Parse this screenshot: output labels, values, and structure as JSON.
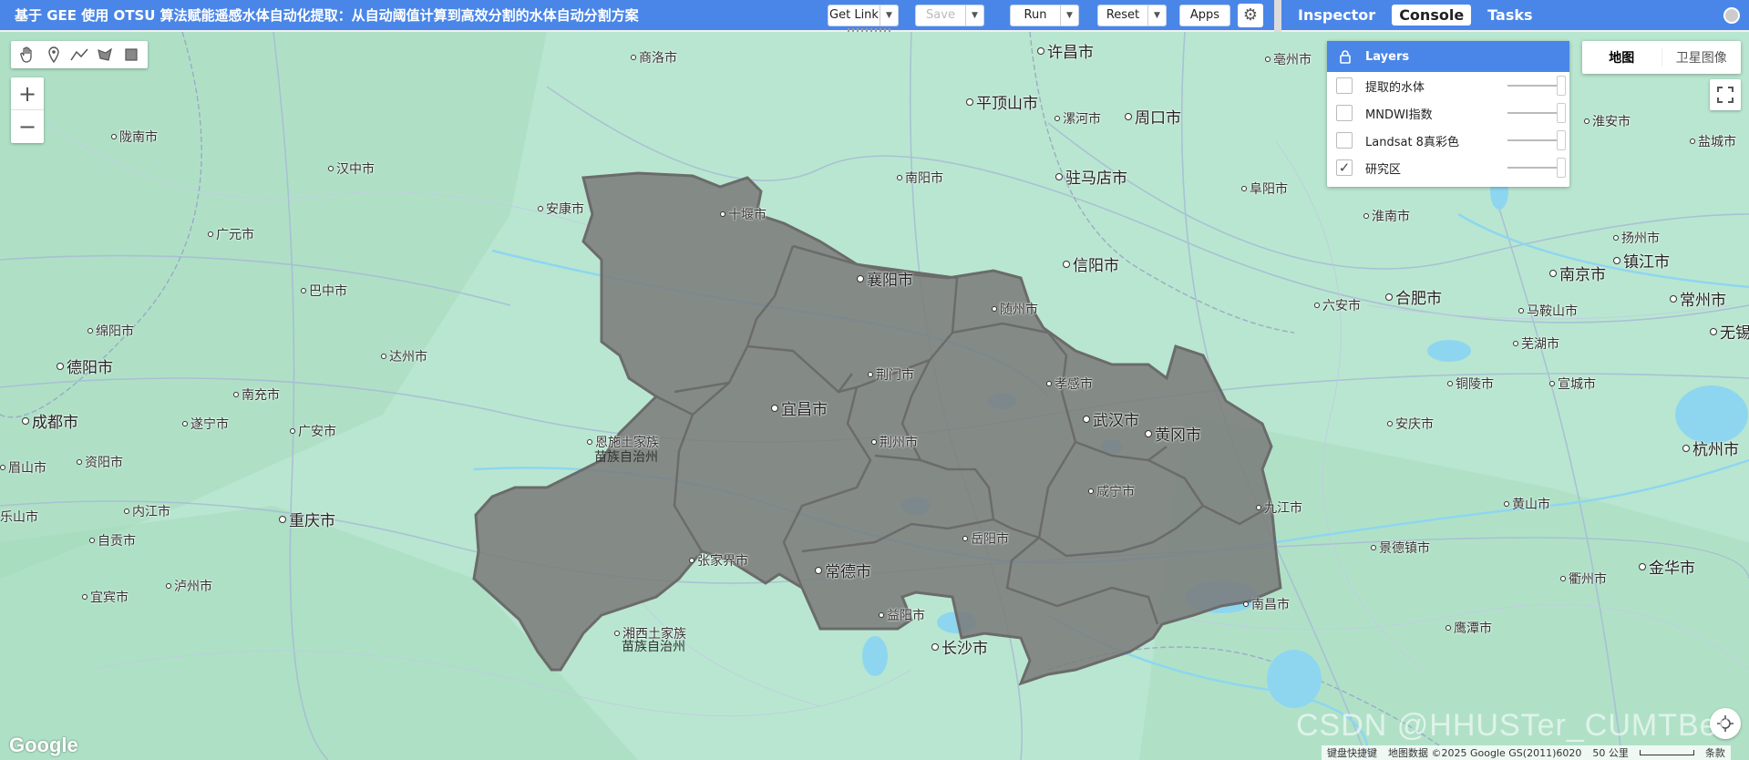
{
  "header": {
    "title": "基于 GEE 使用 OTSU 算法赋能遥感水体自动化提取：从自动阈值计算到高效分割的水体自动分割方案",
    "get_link": "Get Link",
    "save": "Save",
    "run": "Run",
    "reset": "Reset",
    "apps": "Apps"
  },
  "side_tabs": [
    "Inspector",
    "Console",
    "Tasks"
  ],
  "layers": {
    "title": "Layers",
    "items": [
      {
        "name": "提取的水体",
        "checked": false
      },
      {
        "name": "MNDWI指数",
        "checked": false
      },
      {
        "name": "Landsat 8真彩色",
        "checked": false
      },
      {
        "name": "研究区",
        "checked": true
      }
    ]
  },
  "map_type": {
    "map": "地图",
    "satellite": "卫星图像"
  },
  "attribution": {
    "keyboard": "键盘快捷键",
    "data": "地图数据 ©2025 Google GS(2011)6020",
    "scale": "50 公里",
    "terms": "条款"
  },
  "watermark": "CSDN @HHUSTer_CUMTBer",
  "google_logo": "Google",
  "colors": {
    "accent": "#4a86e8",
    "map_land": "#b9e6d0",
    "region_fill": "#7a7a7a",
    "region_stroke": "#6b6b6b",
    "water": "#8ed6f0"
  },
  "icons": {
    "draw_tools": [
      "hand-icon",
      "marker-icon",
      "line-icon",
      "polygon-icon",
      "rectangle-icon"
    ],
    "zoom": [
      "plus-icon",
      "minus-icon"
    ]
  },
  "cities": [
    {
      "name": "许昌市",
      "big": true
    },
    {
      "name": "商洛市",
      "big": false
    },
    {
      "name": "平顶山市",
      "big": true
    },
    {
      "name": "周口市",
      "big": true
    },
    {
      "name": "亳州市",
      "big": false
    },
    {
      "name": "漯河市",
      "big": false
    },
    {
      "name": "陇南市",
      "big": false
    },
    {
      "name": "汉中市",
      "big": false
    },
    {
      "name": "南阳市",
      "big": false
    },
    {
      "name": "驻马店市",
      "big": true
    },
    {
      "name": "阜阳市",
      "big": false
    },
    {
      "name": "淮安市",
      "big": false
    },
    {
      "name": "盐城市",
      "big": false
    },
    {
      "name": "安康市",
      "big": false
    },
    {
      "name": "十堰市",
      "big": false
    },
    {
      "name": "淮南市",
      "big": false
    },
    {
      "name": "扬州市",
      "big": false
    },
    {
      "name": "广元市",
      "big": false
    },
    {
      "name": "镇江市",
      "big": true
    },
    {
      "name": "信阳市",
      "big": true
    },
    {
      "name": "襄阳市",
      "big": true
    },
    {
      "name": "南京市",
      "big": true
    },
    {
      "name": "巴中市",
      "big": false
    },
    {
      "name": "合肥市",
      "big": true
    },
    {
      "name": "常州市",
      "big": true
    },
    {
      "name": "六安市",
      "big": false
    },
    {
      "name": "随州市",
      "big": false
    },
    {
      "name": "马鞍山市",
      "big": false
    },
    {
      "name": "绵阳市",
      "big": false
    },
    {
      "name": "无锡",
      "big": true
    },
    {
      "name": "芜湖市",
      "big": false
    },
    {
      "name": "达州市",
      "big": false
    },
    {
      "name": "德阳市",
      "big": true
    },
    {
      "name": "荆门市",
      "big": false
    },
    {
      "name": "孝感市",
      "big": false
    },
    {
      "name": "铜陵市",
      "big": false
    },
    {
      "name": "宣城市",
      "big": false
    },
    {
      "name": "南充市",
      "big": false
    },
    {
      "name": "宜昌市",
      "big": true
    },
    {
      "name": "成都市",
      "big": true
    },
    {
      "name": "武汉市",
      "big": true
    },
    {
      "name": "遂宁市",
      "big": false
    },
    {
      "name": "安庆市",
      "big": false
    },
    {
      "name": "黄冈市",
      "big": true
    },
    {
      "name": "广安市",
      "big": false
    },
    {
      "name": "恩施土家族",
      "big": false
    },
    {
      "name": "苗族自治州",
      "big": false
    },
    {
      "name": "荆州市",
      "big": false
    },
    {
      "name": "杭州市",
      "big": true
    },
    {
      "name": "眉山市",
      "big": false
    },
    {
      "name": "资阳市",
      "big": false
    },
    {
      "name": "咸宁市",
      "big": false
    },
    {
      "name": "九江市",
      "big": false
    },
    {
      "name": "黄山市",
      "big": false
    },
    {
      "name": "内江市",
      "big": false
    },
    {
      "name": "乐山市",
      "big": false
    },
    {
      "name": "重庆市",
      "big": true
    },
    {
      "name": "岳阳市",
      "big": false
    },
    {
      "name": "自贡市",
      "big": false
    },
    {
      "name": "景德镇市",
      "big": false
    },
    {
      "name": "张家界市",
      "big": false
    },
    {
      "name": "常德市",
      "big": true
    },
    {
      "name": "金华市",
      "big": true
    },
    {
      "name": "泸州市",
      "big": false
    },
    {
      "name": "衢州市",
      "big": false
    },
    {
      "name": "宜宾市",
      "big": false
    },
    {
      "name": "益阳市",
      "big": false
    },
    {
      "name": "南昌市",
      "big": false
    },
    {
      "name": "湘西土家族",
      "big": false
    },
    {
      "name": "苗族自治州",
      "big": false
    },
    {
      "name": "长沙市",
      "big": true
    },
    {
      "name": "鹰潭市",
      "big": false
    }
  ]
}
